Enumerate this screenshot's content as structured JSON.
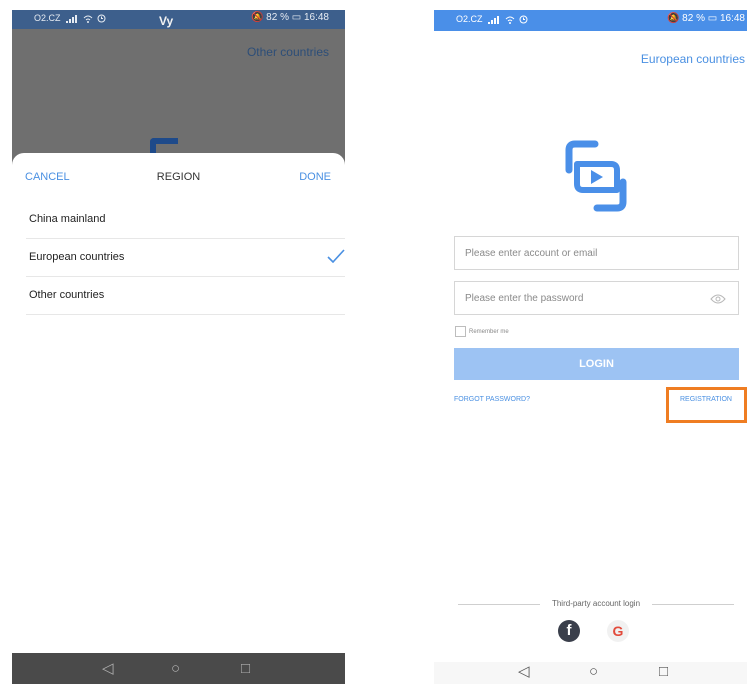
{
  "left_phone": {
    "status": {
      "carrier": "O2.CZ",
      "right": "🔕 82 % ▭ 16:48",
      "overlay_text": "Vy"
    },
    "top_link": "Other countries",
    "sheet": {
      "cancel_label": "CANCEL",
      "title": "REGION",
      "done_label": "DONE",
      "items": [
        {
          "label": "China mainland",
          "selected": false
        },
        {
          "label": "European countries",
          "selected": true
        },
        {
          "label": "Other countries",
          "selected": false
        }
      ]
    },
    "nav": {
      "back": "◁",
      "home": "○",
      "recent": "□"
    }
  },
  "right_phone": {
    "status": {
      "carrier": "O2.CZ",
      "right": "🔕 82 % ▭ 16:48"
    },
    "top_link": "European countries",
    "account_placeholder": "Please enter account or email",
    "password_placeholder": "Please enter the password",
    "remember_label": "Remember me",
    "login_label": "LOGIN",
    "forgot_label": "FORGOT PASSWORD?",
    "registration_label": "REGISTRATION",
    "third_party_label": "Third-party account login",
    "social": {
      "facebook": "f",
      "google": "G"
    },
    "nav": {
      "back": "◁",
      "home": "○",
      "recent": "□"
    }
  },
  "colors": {
    "accent": "#4a90e2",
    "login_button": "#9dc3f3",
    "highlight": "#ef7d22",
    "status_bar": "#4a8fe8"
  },
  "icons": [
    "signal-icon",
    "wifi-icon",
    "alarm-icon",
    "checkmark-icon",
    "eye-icon",
    "app-logo-icon",
    "facebook-icon",
    "google-icon",
    "back-icon",
    "home-icon",
    "recent-apps-icon"
  ]
}
